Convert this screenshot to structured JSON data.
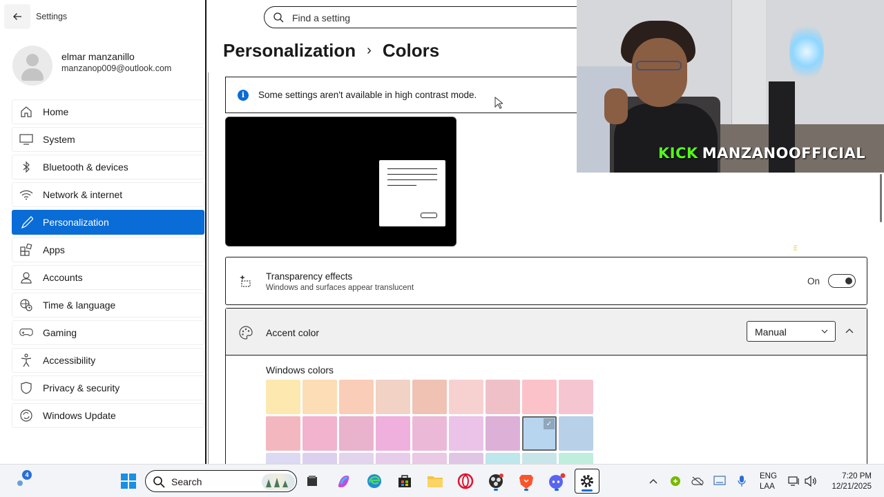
{
  "app": {
    "title": "Settings"
  },
  "profile": {
    "name": "elmar manzanillo",
    "email": "manzanop009@outlook.com"
  },
  "sidebar": {
    "items": [
      {
        "label": "Home",
        "icon": "home-icon",
        "active": false
      },
      {
        "label": "System",
        "icon": "monitor-icon",
        "active": false
      },
      {
        "label": "Bluetooth & devices",
        "icon": "bluetooth-icon",
        "active": false
      },
      {
        "label": "Network & internet",
        "icon": "wifi-icon",
        "active": false
      },
      {
        "label": "Personalization",
        "icon": "brush-icon",
        "active": true
      },
      {
        "label": "Apps",
        "icon": "apps-icon",
        "active": false
      },
      {
        "label": "Accounts",
        "icon": "person-icon",
        "active": false
      },
      {
        "label": "Time & language",
        "icon": "globe-clock-icon",
        "active": false
      },
      {
        "label": "Gaming",
        "icon": "gamepad-icon",
        "active": false
      },
      {
        "label": "Accessibility",
        "icon": "accessibility-icon",
        "active": false
      },
      {
        "label": "Privacy & security",
        "icon": "shield-icon",
        "active": false
      },
      {
        "label": "Windows Update",
        "icon": "update-icon",
        "active": false
      }
    ]
  },
  "search": {
    "placeholder": "Find a setting"
  },
  "header": {
    "parent": "Personalization",
    "separator": "›",
    "current": "Colors"
  },
  "info_bar": {
    "text": "Some settings aren't available in high contrast mode."
  },
  "transparency": {
    "title": "Transparency effects",
    "subtitle": "Windows and surfaces appear translucent",
    "state_label": "On",
    "enabled": true
  },
  "accent": {
    "title": "Accent color",
    "mode": "Manual",
    "windows_colors_label": "Windows colors",
    "swatches": [
      "#fde8b0",
      "#fcddb5",
      "#f9cdb7",
      "#f2d2c4",
      "#f0c2b4",
      "#f7d1d0",
      "#f0c0c9",
      "#fbc3c9",
      "#f5c5d2",
      "#f3b7c0",
      "#f2b3cf",
      "#e9b3cd",
      "#efb0dd",
      "#ecb8d8",
      "#ebc2e8",
      "#ddb0d8",
      "#b8d5ef",
      "#b8d0e8"
    ],
    "selected_index": 16,
    "partial_row": [
      "#dcd9f2",
      "#dcd0ef",
      "#e2d4ec",
      "#e7cde9",
      "#e9c9e3",
      "#e1c5e4",
      "#bde7ea",
      "#c8e6e9",
      "#c0eede"
    ]
  },
  "webcam": {
    "brand": "KICK",
    "channel": "MANZANOOFFICIAL"
  },
  "taskbar": {
    "widget_badge": "4",
    "search_label": "Search",
    "apps": [
      "windows-start-icon",
      "file-explorer-mini-icon",
      "copilot-icon",
      "edge-icon",
      "store-icon",
      "folder-icon",
      "opera-icon",
      "obs-icon",
      "brave-icon",
      "discord-icon",
      "settings-app-icon"
    ],
    "language": {
      "line1": "ENG",
      "line2": "LAA"
    },
    "clock": {
      "time": "7:20 PM",
      "date": "12/21/2025"
    }
  }
}
